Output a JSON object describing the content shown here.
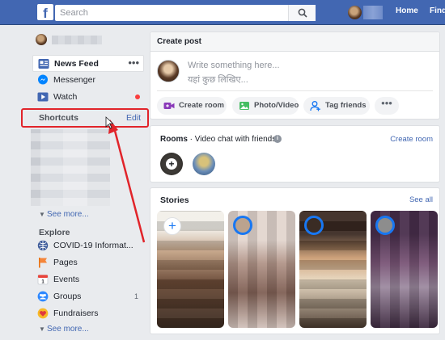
{
  "topbar": {
    "logo": "f",
    "search_placeholder": "Search",
    "links": {
      "home": "Home",
      "find": "Find"
    }
  },
  "sidebar": {
    "items": [
      {
        "label": "News Feed",
        "icon": "news-feed-icon",
        "active": true,
        "more": "•••"
      },
      {
        "label": "Messenger",
        "icon": "messenger-icon"
      },
      {
        "label": "Watch",
        "icon": "watch-icon"
      }
    ],
    "shortcuts": {
      "title": "Shortcuts",
      "edit": "Edit"
    },
    "see_more_1": "See more...",
    "explore": {
      "title": "Explore",
      "items": [
        {
          "label": "COVID-19 Informat...",
          "icon": "covid-info-icon"
        },
        {
          "label": "Pages",
          "icon": "pages-flag-icon"
        },
        {
          "label": "Events",
          "icon": "events-calendar-icon"
        },
        {
          "label": "Groups",
          "icon": "groups-icon",
          "count": "1"
        },
        {
          "label": "Fundraisers",
          "icon": "fundraisers-icon"
        }
      ]
    },
    "see_more_2": "See more..."
  },
  "create_post": {
    "header": "Create post",
    "placeholder_en": "Write something here...",
    "placeholder_hi": "यहां कुछ लिखिए...",
    "actions": [
      {
        "label": "Create room",
        "icon": "video-room-icon"
      },
      {
        "label": "Photo/Video",
        "icon": "photo-icon"
      },
      {
        "label": "Tag friends",
        "icon": "tag-friends-icon"
      }
    ],
    "more": "•••"
  },
  "rooms": {
    "title_bold": "Rooms",
    "title_rest": " · Video chat with friends",
    "info": "i",
    "create": "Create room",
    "plus": "+"
  },
  "stories": {
    "title": "Stories",
    "see_all": "See all",
    "add": "+"
  },
  "colors": {
    "brand": "#4267b2",
    "annotation": "#e1242a",
    "story_ring": "#1877f2"
  }
}
